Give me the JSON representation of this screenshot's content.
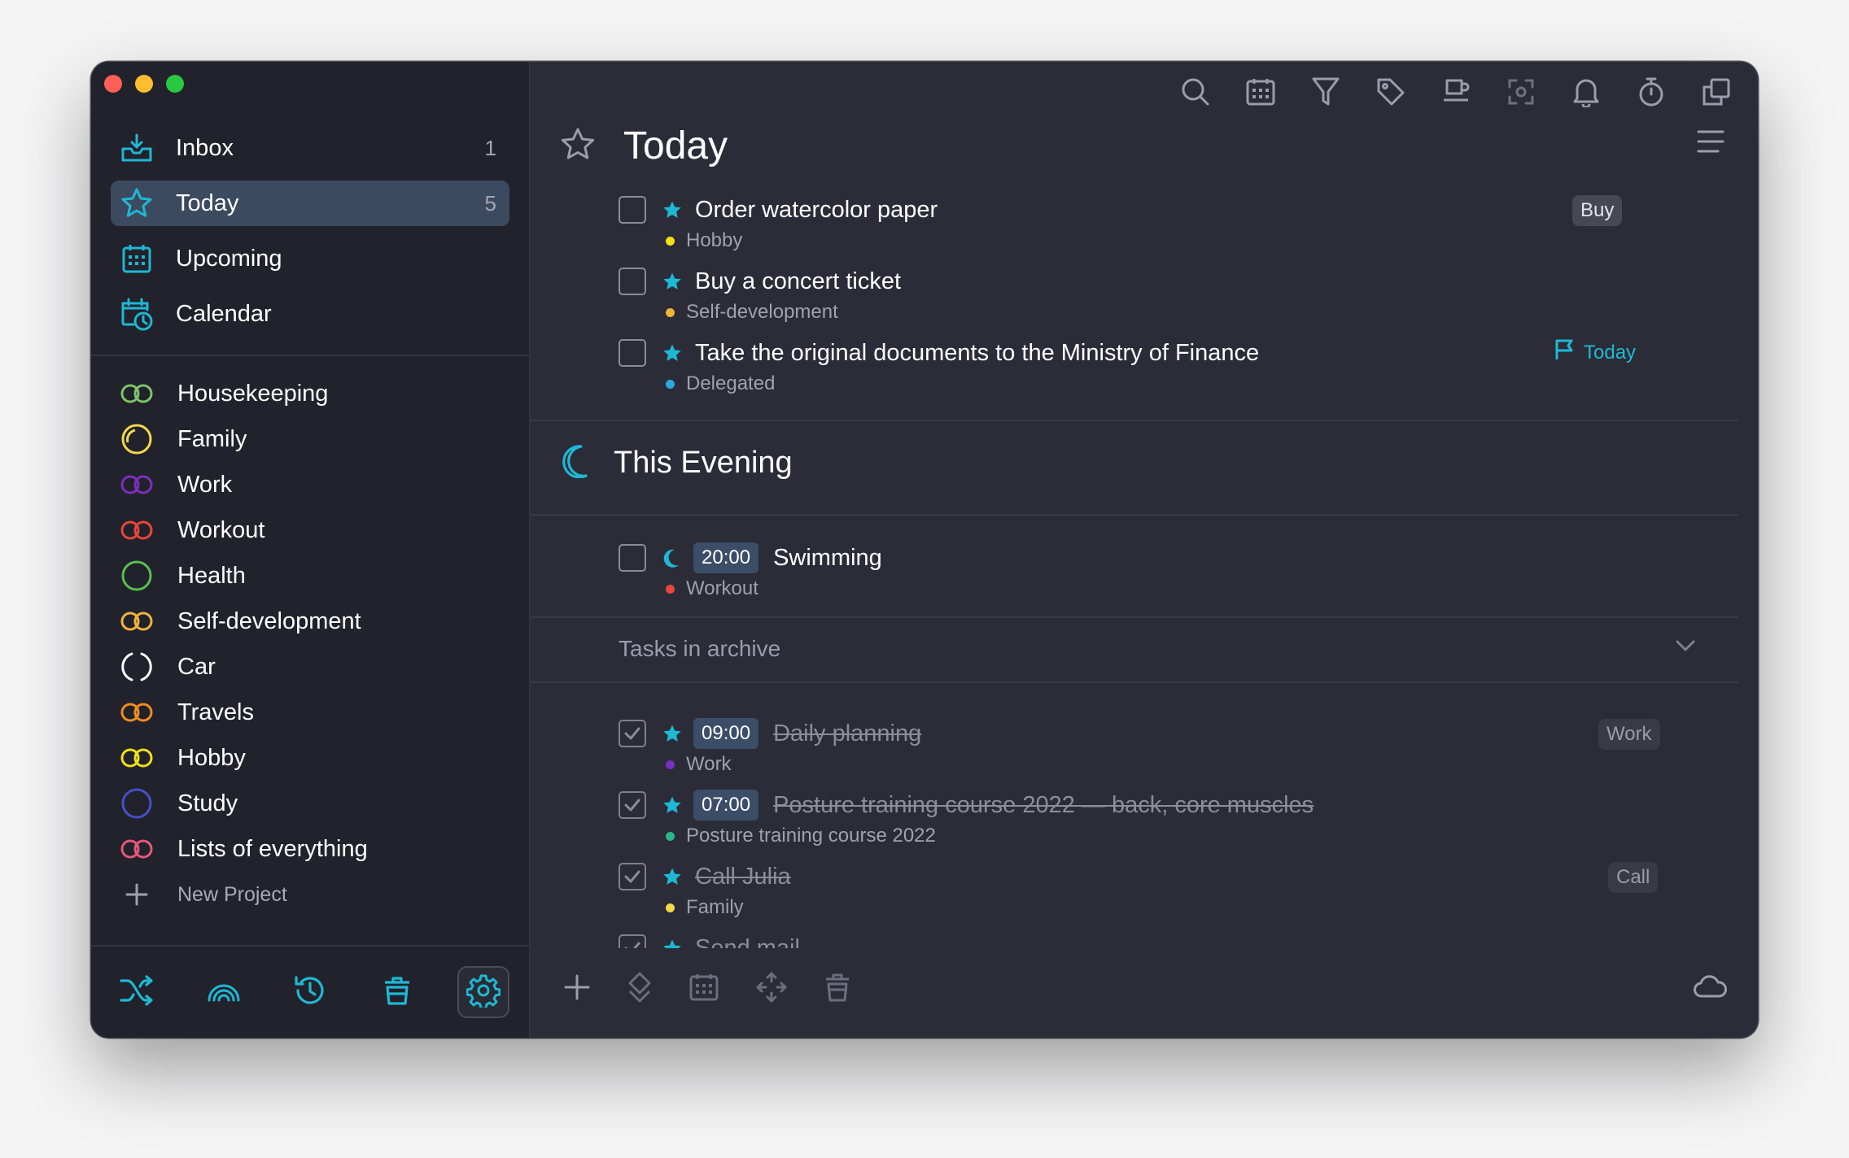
{
  "colors": {
    "accent": "#1fb8d4",
    "sidebar_bg": "#21222b",
    "main_bg": "#2b2c38",
    "active_item": "#3c4a60"
  },
  "sidebar": {
    "nav": [
      {
        "label": "Inbox",
        "count": "1",
        "icon": "inbox-icon"
      },
      {
        "label": "Today",
        "count": "5",
        "icon": "star-icon",
        "active": true
      },
      {
        "label": "Upcoming",
        "count": "",
        "icon": "calendar-grid-icon"
      },
      {
        "label": "Calendar",
        "count": "",
        "icon": "calendar-clock-icon"
      }
    ],
    "projects": [
      {
        "label": "Housekeeping",
        "color": "#7ec36a"
      },
      {
        "label": "Family",
        "color": "#f2d94a"
      },
      {
        "label": "Work",
        "color": "#7b2fbe"
      },
      {
        "label": "Workout",
        "color": "#e8453c"
      },
      {
        "label": "Health",
        "color": "#58c04c"
      },
      {
        "label": "Self-development",
        "color": "#f0b43a"
      },
      {
        "label": "Car",
        "color": "#ffffff"
      },
      {
        "label": "Travels",
        "color": "#f28c1f"
      },
      {
        "label": "Hobby",
        "color": "#f2e018"
      },
      {
        "label": "Study",
        "color": "#4650c8"
      },
      {
        "label": "Lists of everything",
        "color": "#e8577a"
      }
    ],
    "new_project": "New Project",
    "bottom_icons": [
      "shuffle-icon",
      "rainbow-icon",
      "history-icon",
      "trash-icon",
      "settings-icon"
    ]
  },
  "toolbar_icons": [
    "search-icon",
    "calendar-icon",
    "filter-icon",
    "tag-icon",
    "coffee-icon",
    "focus-icon",
    "bell-icon",
    "timer-icon",
    "copy-icon"
  ],
  "header": {
    "title": "Today"
  },
  "today_tasks": [
    {
      "title": "Order watercolor paper",
      "project": "Hobby",
      "dot": "#f2e018",
      "tag": "Buy"
    },
    {
      "title": "Buy a concert ticket",
      "project": "Self-development",
      "dot": "#f0b43a"
    },
    {
      "title": "Take the original documents to the Ministry of Finance",
      "project": "Delegated",
      "dot": "#2aa8e0",
      "flag": "Today"
    }
  ],
  "evening": {
    "title": "This Evening",
    "tasks": [
      {
        "time": "20:00",
        "title": "Swimming",
        "project": "Workout",
        "dot": "#e8453c"
      }
    ]
  },
  "archive": {
    "label": "Tasks in archive",
    "tasks": [
      {
        "time": "09:00",
        "title": "Daily planning",
        "project": "Work",
        "dot": "#7b2fbe",
        "tag": "Work"
      },
      {
        "time": "07:00",
        "title": "Posture training course 2022 — back, core muscles",
        "project": "Posture training course 2022",
        "dot": "#2bb58a"
      },
      {
        "title": "Call Julia",
        "project": "Family",
        "dot": "#f2d94a",
        "tag": "Call"
      },
      {
        "title": "Send mail"
      }
    ]
  },
  "bottom_toolbar_icons": [
    "add-icon",
    "move-icon",
    "calendar-icon",
    "arrows-icon",
    "trash-icon",
    "cloud-icon"
  ]
}
